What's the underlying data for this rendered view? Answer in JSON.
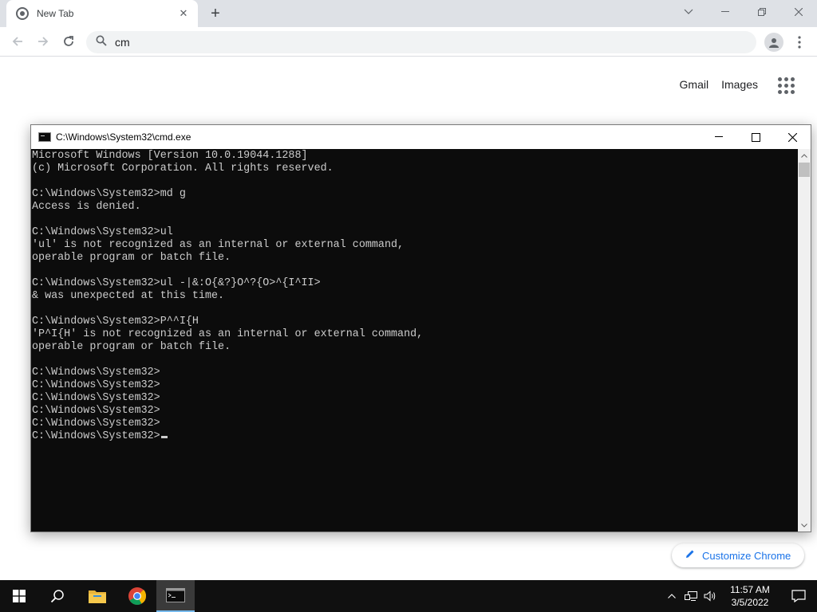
{
  "browser": {
    "tab_title": "New Tab",
    "omnibox_value": "cm",
    "ntp_links": [
      "Gmail",
      "Images"
    ],
    "customize_label": "Customize Chrome"
  },
  "cmd": {
    "title": "C:\\Windows\\System32\\cmd.exe",
    "lines": [
      "Microsoft Windows [Version 10.0.19044.1288]",
      "(c) Microsoft Corporation. All rights reserved.",
      "",
      "C:\\Windows\\System32>md g",
      "Access is denied.",
      "",
      "C:\\Windows\\System32>ul",
      "'ul' is not recognized as an internal or external command,",
      "operable program or batch file.",
      "",
      "C:\\Windows\\System32>ul -|&:O{&?}O^?{O>^{I^II>",
      "& was unexpected at this time.",
      "",
      "C:\\Windows\\System32>P^^I{H",
      "'P^I{H' is not recognized as an internal or external command,",
      "operable program or batch file.",
      "",
      "C:\\Windows\\System32>",
      "C:\\Windows\\System32>",
      "C:\\Windows\\System32>",
      "C:\\Windows\\System32>",
      "C:\\Windows\\System32>",
      "C:\\Windows\\System32>"
    ]
  },
  "taskbar": {
    "time": "11:57 AM",
    "date": "3/5/2022"
  },
  "colors": {
    "chrome_blue": "#1a73e8",
    "console_bg": "#0c0c0c",
    "console_fg": "#cccccc"
  }
}
